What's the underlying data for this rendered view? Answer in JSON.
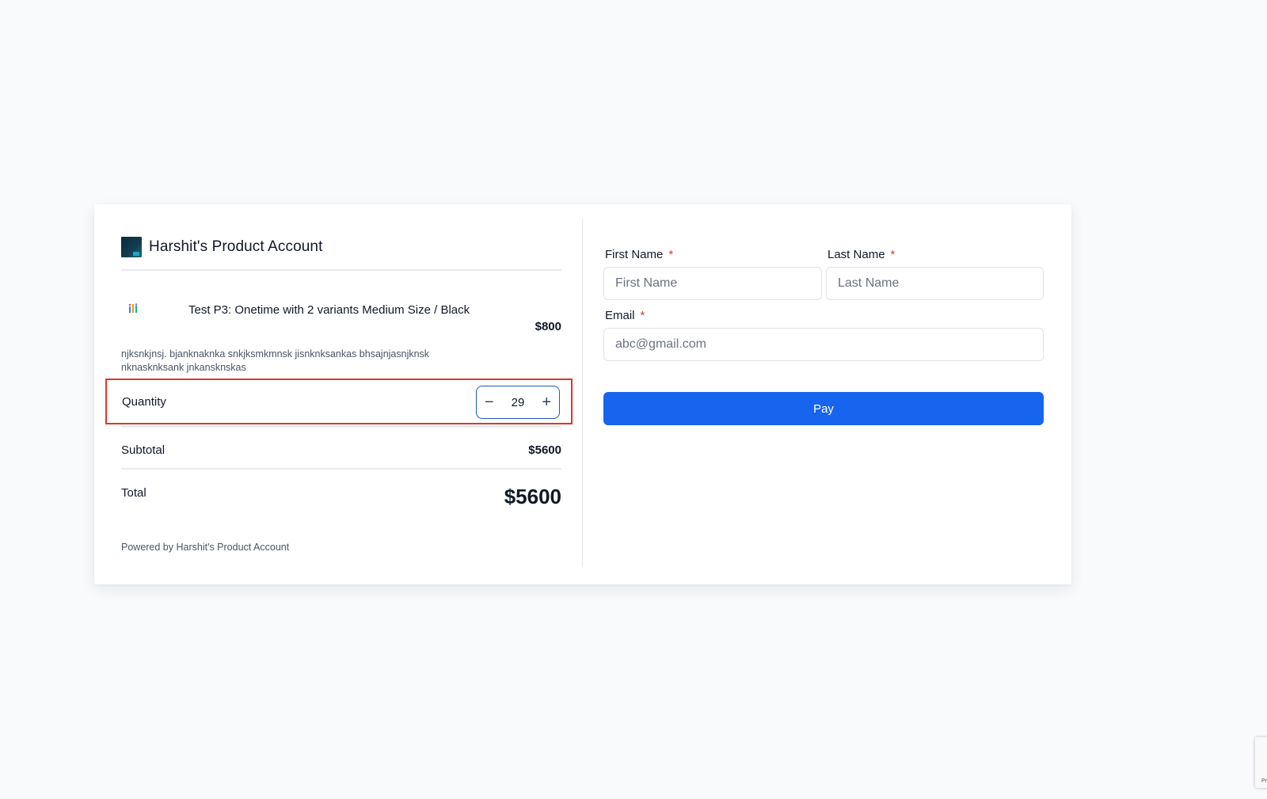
{
  "brand": {
    "name": "Harshit's Product Account"
  },
  "product": {
    "title": "Test P3: Onetime with 2 variants Medium Size / Black",
    "price": "$800",
    "description": "njksnkjnsj. bjanknaknka snkjksmkmnsk jisnknksankas bhsajnjasnjknsk nknasknksank jnkansknskas"
  },
  "quantity": {
    "label": "Quantity",
    "value": "29",
    "decrement_symbol": "−",
    "increment_symbol": "+"
  },
  "summary": {
    "subtotal_label": "Subtotal",
    "subtotal_value": "$5600",
    "total_label": "Total",
    "total_value": "$5600"
  },
  "footer": {
    "powered_by": "Powered by Harshit's Product Account"
  },
  "form": {
    "first_name": {
      "label": "First Name",
      "placeholder": "First Name",
      "required_mark": "*"
    },
    "last_name": {
      "label": "Last Name",
      "placeholder": "Last Name",
      "required_mark": "*"
    },
    "email": {
      "label": "Email",
      "placeholder": "abc@gmail.com",
      "required_mark": "*"
    },
    "pay_label": "Pay"
  },
  "recaptcha": {
    "label": "Pr"
  },
  "colors": {
    "accent": "#1764ee",
    "highlight_border": "#d9392b",
    "required": "#d9392b",
    "background": "#f9fafc"
  },
  "icons": {
    "brand_logo": "brand-logo-icon",
    "product": "product-thumbnail-icon",
    "minus": "minus-icon",
    "plus": "plus-icon"
  }
}
